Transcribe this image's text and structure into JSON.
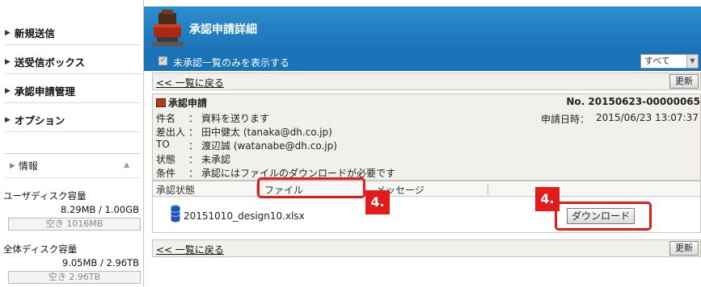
{
  "sidebar": {
    "items": [
      {
        "label": "新規送信"
      },
      {
        "label": "送受信ボックス"
      },
      {
        "label": "承認申請管理"
      },
      {
        "label": "オプション"
      }
    ],
    "info": {
      "title": "情報",
      "user_disk_label": "ユーザディスク容量",
      "user_disk_value": "8.29MB / 1.00GB",
      "user_disk_free": "空き 1016MB",
      "total_disk_label": "全体ディスク容量",
      "total_disk_value": "9.05MB / 2.96TB",
      "total_disk_free": "空き 2.96TB"
    }
  },
  "header": {
    "title": "承認申請詳細"
  },
  "filter": {
    "checkbox_label": "未承認一覧のみを表示する",
    "select_value": "すべて"
  },
  "nav": {
    "back_label": "<< 一覧に戻る",
    "refresh_label": "更新"
  },
  "detail": {
    "heading": "承認申請",
    "number": "No. 20150623-00000065",
    "fields": [
      {
        "label": "件名",
        "value": "資料を送ります"
      },
      {
        "label": "差出人",
        "value": "田中健太 (tanaka@dh.co.jp)"
      },
      {
        "label": "TO",
        "value": "渡辺誠 (watanabe@dh.co.jp)"
      },
      {
        "label": "状態",
        "value": "未承認"
      },
      {
        "label": "条件",
        "value": "承認にはファイルのダウンロードが必要です"
      }
    ],
    "date_label": "申請日時：",
    "date_value": "2015/06/23 13:07:37"
  },
  "table": {
    "columns": [
      "承認状態",
      "ファイル",
      "メッセージ"
    ],
    "file_name": "20151010_design10.xlsx",
    "download_label": "ダウンロード"
  },
  "annotations": {
    "badge_file": "4.",
    "badge_download": "4."
  },
  "colors": {
    "header_blue": "#1a73b6",
    "highlight_red": "#e21b1b"
  }
}
